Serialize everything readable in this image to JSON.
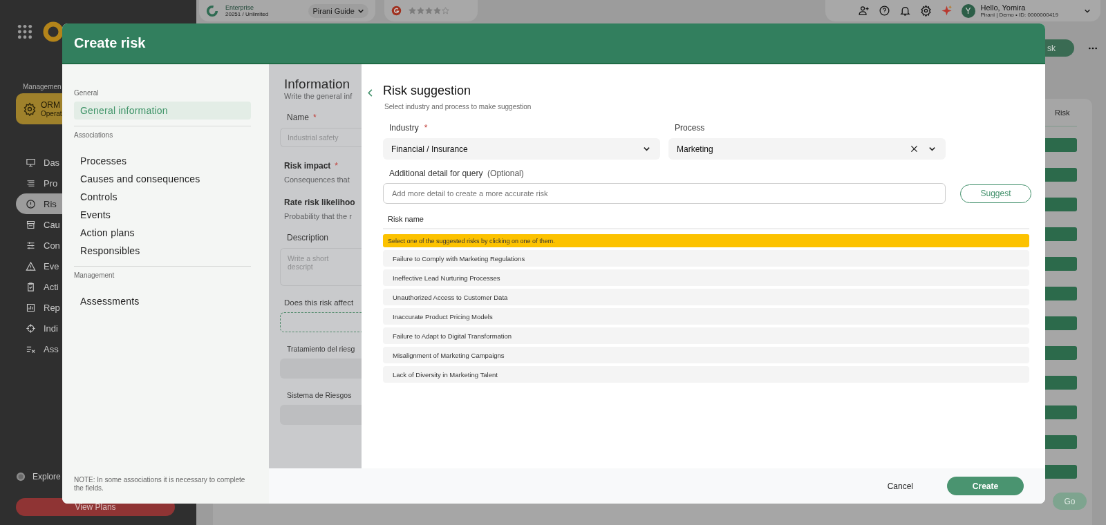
{
  "app": {
    "sidebar": {
      "section": "Managemen",
      "module": {
        "title": "ORM",
        "subtitle": "Operat"
      },
      "items": [
        {
          "label": "Das",
          "selected": false
        },
        {
          "label": "Pro",
          "selected": false
        },
        {
          "label": "Ris",
          "selected": true
        },
        {
          "label": "Cau",
          "selected": false
        },
        {
          "label": "Con",
          "selected": false
        },
        {
          "label": "Eve",
          "selected": false
        },
        {
          "label": "Acti",
          "selected": false
        },
        {
          "label": "Rep",
          "selected": false
        },
        {
          "label": "Indi",
          "selected": false
        },
        {
          "label": "Ass",
          "selected": false
        }
      ],
      "explore": "Explore",
      "plans_button": "View Plans"
    },
    "topbar": {
      "plan": {
        "name": "Enterprise",
        "detail": "20251 / Unlimited"
      },
      "guide": "Pirani Guide",
      "rating": {
        "stars": 4
      },
      "greeting": "Hello, Yomira",
      "account": "Pirani | Demo • ID: 0000000419",
      "avatar": "Y"
    },
    "page": {
      "action_button": "sk",
      "column_header": "Risk",
      "go_button": "Go"
    }
  },
  "dialog": {
    "title": "Create risk",
    "nav": {
      "sections": [
        {
          "heading": "General",
          "items": [
            {
              "label": "General information",
              "selected": true
            }
          ]
        },
        {
          "heading": "Associations",
          "items": [
            {
              "label": "Processes",
              "selected": false
            },
            {
              "label": "Causes and consequences",
              "selected": false
            },
            {
              "label": "Controls",
              "selected": false
            },
            {
              "label": "Events",
              "selected": false
            },
            {
              "label": "Action plans",
              "selected": false
            },
            {
              "label": "Responsibles",
              "selected": false
            }
          ]
        },
        {
          "heading": "Management",
          "items": [
            {
              "label": "Assessments",
              "selected": false
            }
          ]
        }
      ],
      "note": "NOTE: In some associations it is necessary to complete the fields."
    },
    "form": {
      "title": "Information",
      "subtitle": "Write the general inf",
      "fields": [
        {
          "kind": "input",
          "label": "Name",
          "required_mark": "*",
          "placeholder": "Industrial safety"
        },
        {
          "kind": "section",
          "label": "Risk impact",
          "required_mark": "*",
          "hint": "Consequences that"
        },
        {
          "kind": "section",
          "label": "Rate risk likelihoo",
          "hint": "Probability that the r"
        },
        {
          "kind": "textarea",
          "label": "Description",
          "placeholder": "Write a short descript"
        },
        {
          "kind": "dropzone",
          "label": "Does this risk affect"
        },
        {
          "kind": "select",
          "label": "Tratamiento del riesg"
        },
        {
          "kind": "select",
          "label": "Sistema de Riesgos"
        }
      ]
    },
    "suggestion": {
      "title": "Risk suggestion",
      "subtitle": "Select industry and process to make suggestion",
      "industry": {
        "label": "Industry",
        "required_mark": "*",
        "value": "Financial / Insurance"
      },
      "process": {
        "label": "Process",
        "value": "Marketing",
        "clearable": true
      },
      "detail": {
        "label": "Additional detail for query",
        "optional": "(Optional)",
        "placeholder": "Add more detail to create a more accurate risk"
      },
      "suggest_button": "Suggest",
      "list_header": "Risk name",
      "notice": "Select one of the suggested risks by clicking on one of them.",
      "risks": [
        "Failure to Comply with Marketing Regulations",
        "Ineffective Lead Nurturing Processes",
        "Unauthorized Access to Customer Data",
        "Inaccurate Product Pricing Models",
        "Failure to Adapt to Digital Transformation",
        "Misalignment of Marketing Campaigns",
        "Lack of Diversity in Marketing Talent"
      ]
    },
    "footer": {
      "cancel": "Cancel",
      "create": "Create"
    }
  }
}
